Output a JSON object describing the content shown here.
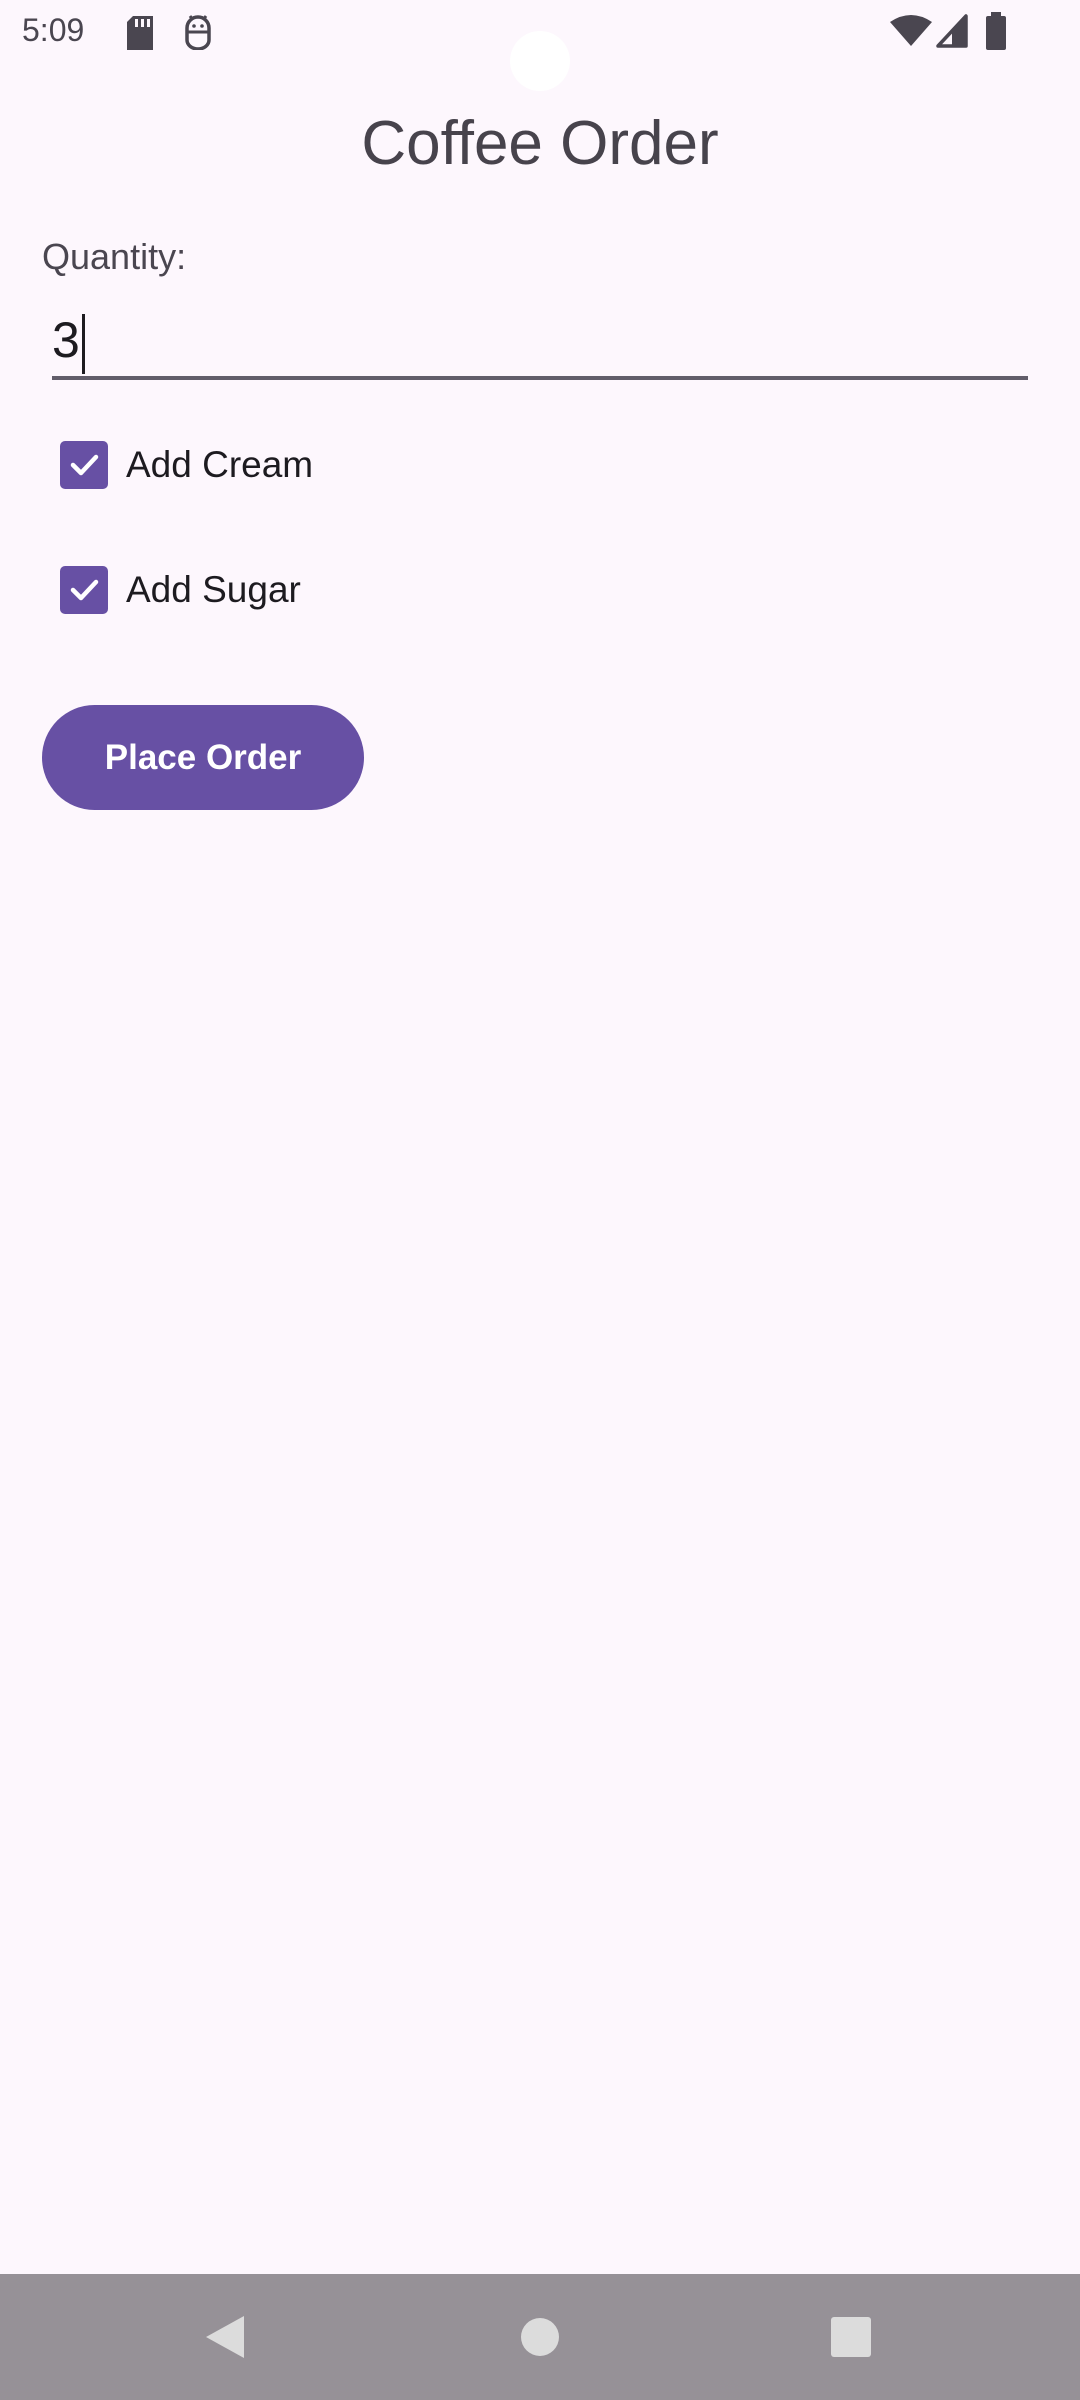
{
  "status_bar": {
    "time": "5:09",
    "left_icons": [
      "sd-card-icon",
      "android-debug-icon"
    ],
    "right_icons": [
      "wifi-icon",
      "cellular-signal-icon",
      "battery-icon"
    ]
  },
  "header": {
    "title": "Coffee Order"
  },
  "form": {
    "quantity_label": "Quantity:",
    "quantity_value": "3",
    "options": [
      {
        "label": "Add Cream",
        "checked": true
      },
      {
        "label": "Add Sugar",
        "checked": true
      }
    ],
    "submit_label": "Place Order"
  },
  "navigation": {
    "buttons": [
      "back-icon",
      "home-icon",
      "recents-icon"
    ]
  },
  "colors": {
    "background": "#fdf7fd",
    "accent": "#6750a4",
    "nav_bar": "#969197"
  }
}
